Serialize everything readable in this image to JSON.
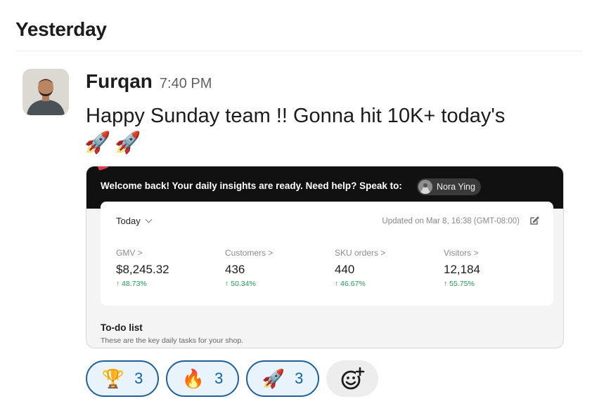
{
  "day_header": "Yesterday",
  "message": {
    "author": "Furqan",
    "time": "7:40 PM",
    "text": "Happy Sunday team !! Gonna hit 10K+ today's",
    "emojis": [
      "🚀",
      "🚀"
    ]
  },
  "attachment": {
    "banner_text": "Welcome back! Your daily insights are ready. Need help? Speak to:",
    "contact_name": "Nora Ying",
    "range": "Today",
    "updated": "Updated on Mar 8, 16:38 (GMT-08:00)",
    "metrics": [
      {
        "label": "GMV >",
        "value": "$8,245.32",
        "change": "↑ 48.73%"
      },
      {
        "label": "Customers >",
        "value": "436",
        "change": "↑ 50.34%"
      },
      {
        "label": "SKU orders >",
        "value": "440",
        "change": "↑ 46.67%"
      },
      {
        "label": "Visitors >",
        "value": "12,184",
        "change": "↑ 55.75%"
      }
    ],
    "todo_title": "To-do list",
    "todo_subtitle": "These are the key daily tasks for your shop."
  },
  "reactions": [
    {
      "emoji": "🏆",
      "count": "3"
    },
    {
      "emoji": "🔥",
      "count": "3"
    },
    {
      "emoji": "🚀",
      "count": "3"
    }
  ],
  "colors": {
    "reaction_border": "#1f5f9e",
    "reaction_bg": "#e8f3fc",
    "positive_change": "#1f9d55",
    "banner_bg": "#111111"
  }
}
